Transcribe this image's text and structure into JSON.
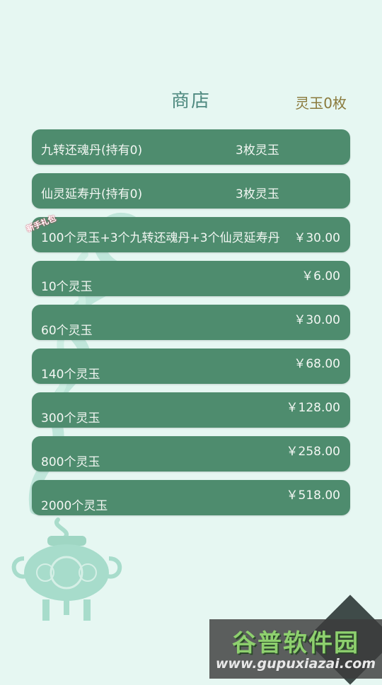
{
  "header": {
    "title": "商店",
    "balance": "灵玉0枚"
  },
  "items": [
    {
      "name": "九转还魂丹(持有0)",
      "price": "3枚灵玉"
    },
    {
      "name": "仙灵延寿丹(持有0)",
      "price": "3枚灵玉"
    },
    {
      "name": "100个灵玉+3个九转还魂丹+3个仙灵延寿丹",
      "price": "￥30.00",
      "badge": "新手礼包"
    },
    {
      "name": "10个灵玉",
      "price": "￥6.00"
    },
    {
      "name": "60个灵玉",
      "price": "￥30.00"
    },
    {
      "name": "140个灵玉",
      "price": "￥68.00"
    },
    {
      "name": "300个灵玉",
      "price": "￥128.00"
    },
    {
      "name": "800个灵玉",
      "price": "￥258.00"
    },
    {
      "name": "2000个灵玉",
      "price": "￥518.00"
    }
  ],
  "watermark": {
    "title": "谷普软件园",
    "url": "www.gupuxiazai.com"
  },
  "colors": {
    "background": "#e6f7f2",
    "card": "#4e8c6e",
    "title": "#4f8a80",
    "balance": "#8a7a3c"
  },
  "icons": {
    "decoration_left": "incense-smoke-decoration",
    "decoration_bottom": "incense-burner-icon"
  }
}
